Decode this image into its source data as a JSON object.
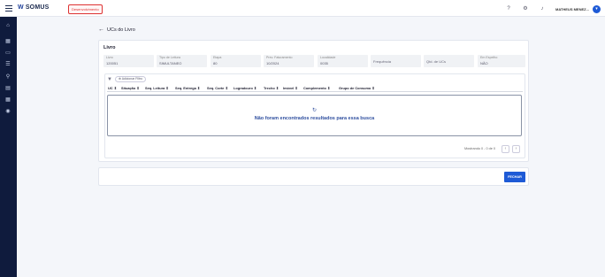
{
  "topbar": {
    "logo_mark": "W",
    "logo_text": "SOMUS",
    "environment_badge": "Desenvolvimento",
    "user_name": "MATHEUS MENEZ...",
    "user_initial": "M"
  },
  "page": {
    "title": "UCs do Livro"
  },
  "livro": {
    "section_title": "Livro",
    "fields": [
      {
        "label": "Livro",
        "value": "120051"
      },
      {
        "label": "Tipo de Leitura",
        "value": "SIMULTANEO"
      },
      {
        "label": "Etapa",
        "value": "80"
      },
      {
        "label": "Prev. Faturamento",
        "value": "10/2024"
      },
      {
        "label": "Localidade",
        "value": "0035"
      },
      {
        "label": "",
        "value": "Frequência"
      },
      {
        "label": "",
        "value": "Qtd. de UCs"
      },
      {
        "label": "Em Espelho",
        "value": "NÃO"
      }
    ]
  },
  "grid": {
    "add_filter_label": "Adicionar Filtro",
    "columns": [
      "UC",
      "Situação",
      "Seq. Leitura",
      "Seq. Entrega",
      "Seq. Corte",
      "Logradouro",
      "Trecho",
      "Imóvel",
      "Complemento",
      "Grupo de Consumo"
    ],
    "sort_indicator": "⇕",
    "empty_message": "Não foram encontrados resultados para essa busca",
    "pagination_text": "Mostrando 0 - 0 de 0",
    "prev_label": "‹",
    "next_label": "›"
  },
  "footer": {
    "close_label": "FECHAR"
  }
}
